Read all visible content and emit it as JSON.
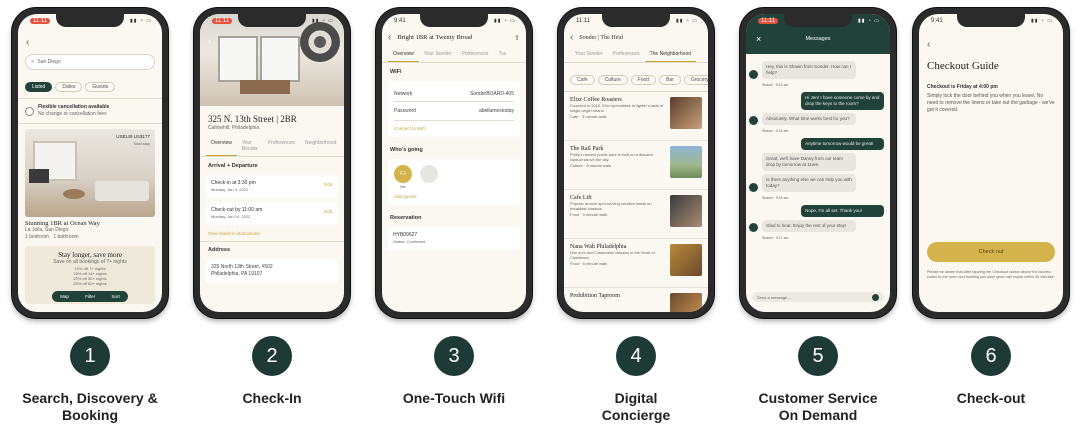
{
  "steps": [
    {
      "number": "1",
      "caption_lines": [
        "Search, Discovery &",
        "Booking"
      ]
    },
    {
      "number": "2",
      "caption_lines": [
        "Check-In",
        ""
      ]
    },
    {
      "number": "3",
      "caption_lines": [
        "One-Touch Wifi",
        ""
      ]
    },
    {
      "number": "4",
      "caption_lines": [
        "Digital",
        "Concierge"
      ]
    },
    {
      "number": "5",
      "caption_lines": [
        "Customer Service",
        "On Demand"
      ]
    },
    {
      "number": "6",
      "caption_lines": [
        "Check-out",
        ""
      ]
    }
  ],
  "p1": {
    "time": "11:11",
    "search_placeholder": "San Diego",
    "filters": [
      "Listed",
      "Dates",
      "Guests"
    ],
    "notice_title": "Flexible cancellation available",
    "notice_sub": "No change or cancellation fees",
    "price": "US$149 US$177",
    "price_sub": "Total stay",
    "listing_title": "Stunning 1BR at Ocean Way",
    "listing_sub1": "La Jolla, San Diego",
    "listing_sub2": "1 bedroom · 1 bathroom",
    "promo_title": "Stay longer, save more",
    "promo_sub": "Save on all bookings of 7+ nights",
    "promo_lines": [
      "10% off 7+ nights",
      "15% off 14+ nights",
      "20% off 30+ nights",
      "25% off 60+ nights"
    ],
    "bar": [
      "Map",
      "Filter",
      "Sort"
    ]
  },
  "p2": {
    "time": "11:11",
    "title": "325 N. 13th Street | 2BR",
    "subtitle": "Callowhill, Philadelphia",
    "tabs": [
      "Overview",
      "Your Bonder",
      "Preferences",
      "Neighborhood"
    ],
    "section": "Arrival + Departure",
    "checkin": "Check-in at 3:30 pm",
    "checkin_date": "Monday, Jan 3, 2022",
    "checkout": "Check-out by 11:00 am",
    "checkout_date": "Monday, Jan 10, 2022",
    "edit": "Edit",
    "more": "View check-in instructions",
    "address_label": "Address",
    "address": "325 North 13th Street, #502\nPhiladelphia, PA 19107"
  },
  "p3": {
    "time": "9:41",
    "title": "Bright 1BR at Twenty Broad",
    "tabs": [
      "Overview",
      "Your Sonder",
      "Preferences",
      "Tra"
    ],
    "wifi_label": "WiFi",
    "network_label": "Network",
    "network_value": "SonderBOARD-405",
    "password_label": "Password",
    "password_value": "abellamestoday",
    "connect": "Connect to WiFi",
    "whos_going": "Who's going",
    "initials": "FJ",
    "me": "Me",
    "add_guests": "Add guests",
    "reservation": "Reservation",
    "res_code": "HYB09627",
    "res_status": "Status: Confirmed"
  },
  "p4": {
    "time": "11:11",
    "title": "Sonder | The Heid",
    "tabs": [
      "Your Sonder",
      "Preferences",
      "The Neighborhood"
    ],
    "chips": [
      "Cafe",
      "Culture",
      "Food",
      "Bar",
      "Grocery"
    ],
    "places": [
      {
        "name": "Elixr Coffee Roasters",
        "desc": "Founded in 2010, Elixr specializes in lighter roasts of single-origin beans.",
        "meta": "Cafe · 3 minute walk"
      },
      {
        "name": "The Rail Park",
        "desc": "Philly's newest public park is built on a disused viaduct above the city.",
        "meta": "Culture · 8 minute walk"
      },
      {
        "name": "Cafe Lift",
        "desc": "Popular brunch spot serving creative twists on breakfast classics.",
        "meta": "Food · 5 minute walk"
      },
      {
        "name": "Nana Wah Philadelphia",
        "desc": "Dim sum and Cantonese classics in the heart of Chinatown.",
        "meta": "Food · 6 minute walk"
      },
      {
        "name": "Prohibition Taproom",
        "desc": "",
        "meta": ""
      }
    ]
  },
  "p5": {
    "time": "11:11",
    "title": "Messages",
    "messages": [
      {
        "side": "l",
        "text": "Hey, this is Shawn from Sonder. How can I help?",
        "meta": "Shawn · 9:14 am"
      },
      {
        "side": "r",
        "text": "Hi Jen! I have someone come by and drop the keys to the room?",
        "meta": ""
      },
      {
        "side": "l",
        "text": "Absolutely. What time works best for you?",
        "meta": "Shawn · 9:15 am"
      },
      {
        "side": "r",
        "text": "Anytime tomorrow would be great!",
        "meta": ""
      },
      {
        "side": "l",
        "text": "Great, we'll have Danny from our team drop by tomorrow at 11am.",
        "meta": ""
      },
      {
        "side": "l",
        "text": "Is there anything else we can help you with today?",
        "meta": "Shawn · 9:16 am"
      },
      {
        "side": "r",
        "text": "Nope, I'm all set. Thank you!",
        "meta": ""
      },
      {
        "side": "l",
        "text": "Glad to hear. Enjoy the rest of your stay!",
        "meta": "Shawn · 9:17 am"
      }
    ],
    "input_placeholder": "Send a message..."
  },
  "p6": {
    "time": "9:41",
    "title": "Checkout Guide",
    "subtitle": "Checkout is Friday at 4:00 pm",
    "body": "Simply lock the door behind you when you leave. No need to remove the linens or take out the garbage - we've got it covered.",
    "button": "Check out",
    "foot": "Please be aware that after tapping the Checkout button above the access codes to the room and building you were given will expire within 30 minutes."
  },
  "colors": {
    "forest": "#1d3b34",
    "gold": "#d4b24c",
    "cream": "#fbf8f1"
  }
}
